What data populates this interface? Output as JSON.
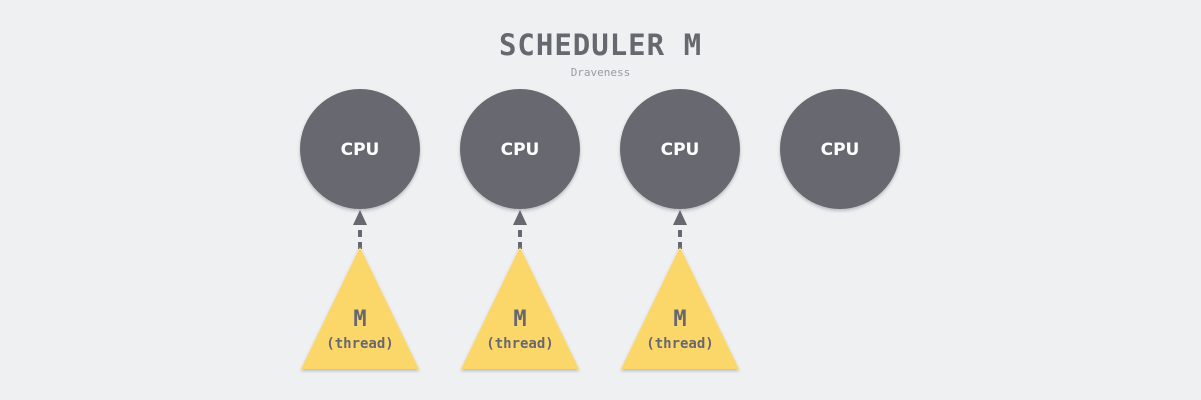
{
  "title": "SCHEDULER M",
  "subtitle": "Draveness",
  "colors": {
    "background": "#eff0f2",
    "cpu_fill": "#686770",
    "thread_fill": "#fbd76a",
    "text": "#686770",
    "arrow": "#686770"
  },
  "cpus": [
    {
      "label": "CPU"
    },
    {
      "label": "CPU"
    },
    {
      "label": "CPU"
    },
    {
      "label": "CPU"
    }
  ],
  "threads": [
    {
      "name": "M",
      "sub": "(thread)",
      "cpu_index": 0
    },
    {
      "name": "M",
      "sub": "(thread)",
      "cpu_index": 1
    },
    {
      "name": "M",
      "sub": "(thread)",
      "cpu_index": 2
    }
  ]
}
